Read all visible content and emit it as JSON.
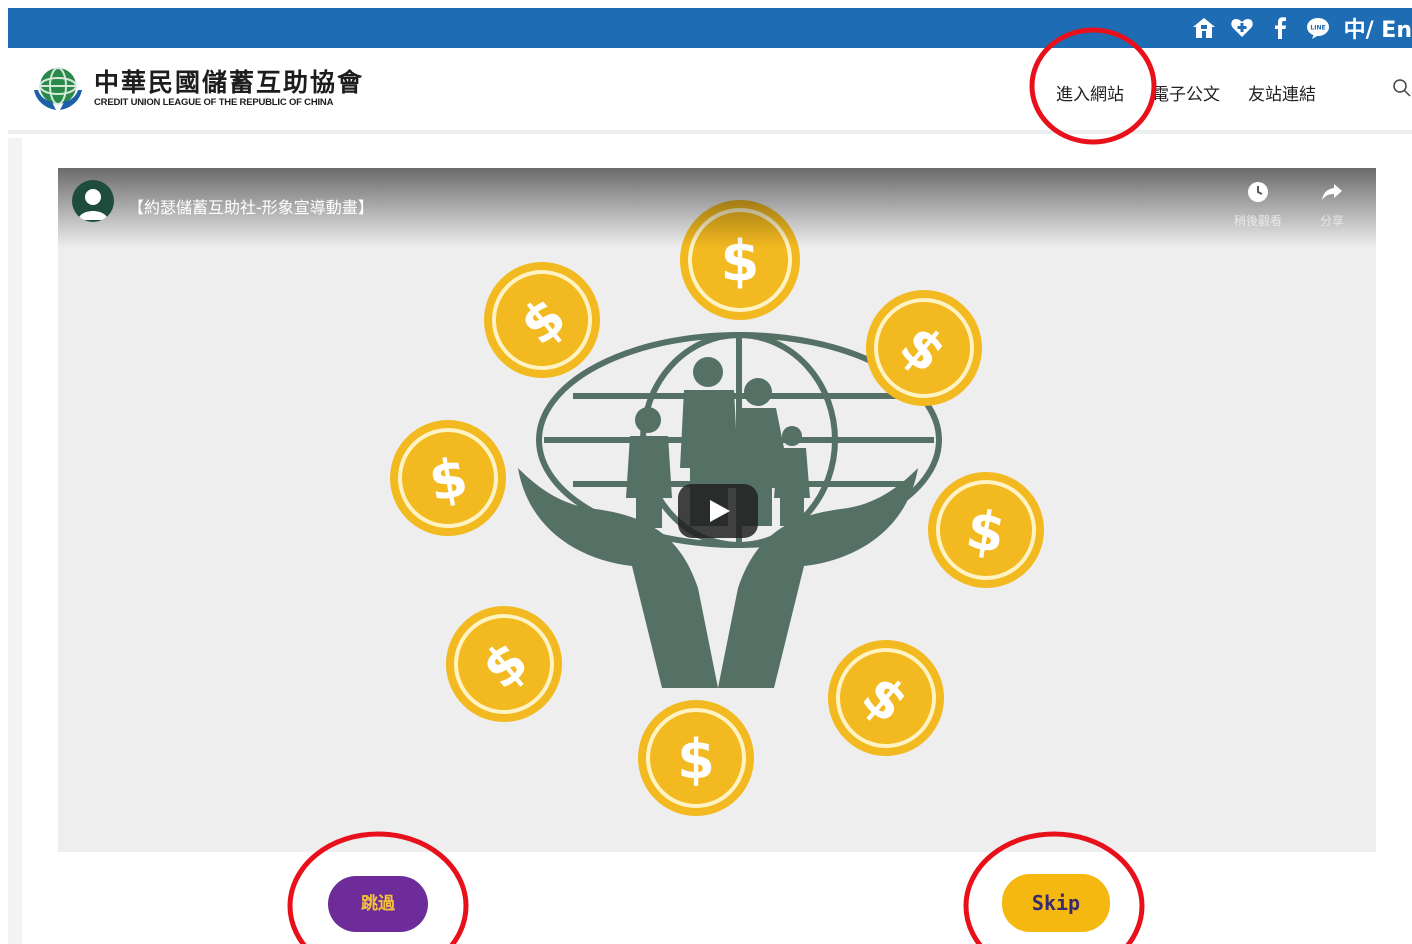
{
  "topbar": {
    "icons": [
      "home-icon",
      "heart-plus-icon",
      "facebook-icon",
      "line-icon"
    ],
    "language": "中/ En",
    "colors": {
      "background": "#1e6db4"
    }
  },
  "header": {
    "logo": {
      "name_zh": "中華民國儲蓄互助協會",
      "name_en": "CREDIT UNION LEAGUE OF THE REPUBLIC OF CHINA"
    },
    "nav": [
      {
        "label": "進入網站"
      },
      {
        "label": "電子公文"
      },
      {
        "label": "友站連結"
      }
    ],
    "search_icon": "search-icon"
  },
  "video": {
    "title": "【約瑟儲蓄互助社-形象宣導動畫】",
    "watch_later_label": "稍後觀看",
    "share_label": "分享",
    "coin_symbol": "$"
  },
  "buttons": {
    "skip_zh": "跳過",
    "skip_en": "Skip"
  },
  "colors": {
    "accent_purple": "#6e2c9a",
    "accent_yellow": "#f4b811",
    "coin": "#f2b920",
    "illustration_green": "#557065",
    "annotation_red": "#e8101a"
  }
}
